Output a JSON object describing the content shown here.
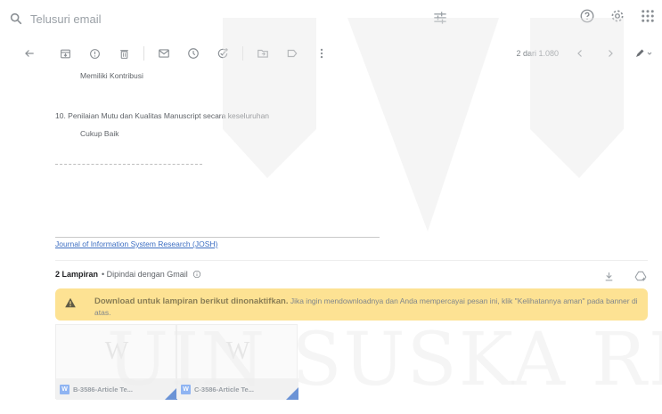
{
  "search": {
    "placeholder": "Telusuri email"
  },
  "toolbar": {
    "pager": "2 dari 1.080"
  },
  "message": {
    "line_top": "Memiliki Kontribusi",
    "item_10": "10. Penilaian Mutu dan Kualitas Manuscript secara keseluruhan",
    "item_10_answer": "Cukup Baik",
    "signature_link": "Journal of Information System Research (JOSH)"
  },
  "attachments": {
    "count_label": "2 Lampiran",
    "scanned_label": "• Dipindai dengan Gmail",
    "warning_bold": "Download untuk lampiran berikut dinonaktifkan.",
    "warning_text": " Jika ingin mendownloadnya dan Anda mempercayai pesan ini, klik \"Kelihatannya aman\" pada banner di atas.",
    "files": [
      {
        "name": "B-3586-Article Te...",
        "preview_letter": "W",
        "badge": "W"
      },
      {
        "name": "C-3586-Article Te...",
        "preview_letter": "W",
        "badge": "W"
      }
    ]
  },
  "watermark": {
    "text": "UIN SUSKA RI"
  },
  "icons": [
    "search-icon",
    "tune-icon",
    "help-icon",
    "settings-icon",
    "apps-icon",
    "back-icon",
    "archive-icon",
    "report-spam-icon",
    "delete-icon",
    "mark-unread-icon",
    "snooze-icon",
    "add-task-icon",
    "move-to-icon",
    "label-icon",
    "more-icon",
    "prev-icon",
    "next-icon",
    "pen-icon",
    "download-icon",
    "add-to-drive-icon",
    "info-icon",
    "warning-icon"
  ],
  "colors": {
    "warning_bg": "#fde293",
    "link": "#3c6ec2",
    "doc_badge": "#8fb4f2"
  }
}
